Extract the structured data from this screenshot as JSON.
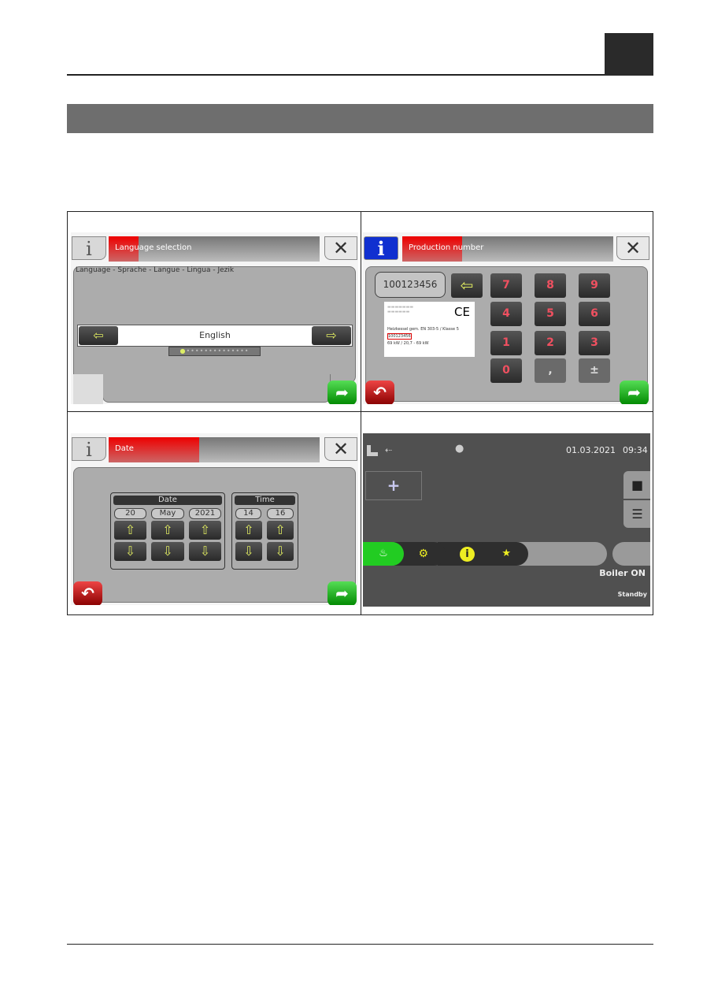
{
  "screens": {
    "language": {
      "title": "Language selection",
      "prompt": "Language - Sprache - Langue - Lingua - Jezik",
      "value": "English",
      "info_icon": "info-icon",
      "close_icon": "close-icon"
    },
    "production": {
      "title": "Production number",
      "value": "100123456",
      "keys": [
        "7",
        "8",
        "9",
        "4",
        "5",
        "6",
        "1",
        "2",
        "3",
        "0",
        ",",
        "±"
      ],
      "label_line1": "Heizkessel gem. EN 303-5 / Klasse 5",
      "label_number": "100123456",
      "label_line2": "69 kW / 20,7 - 69 kW",
      "ce_mark": "CE"
    },
    "date": {
      "title": "Date",
      "date_label": "Date",
      "time_label": "Time",
      "day": "20",
      "month": "May",
      "year": "2021",
      "hour": "14",
      "minute": "16"
    },
    "home": {
      "date": "01.03.2021",
      "time": "09:34",
      "add": "+",
      "status": "Boiler ON",
      "substatus": "Standby"
    }
  },
  "colors": {
    "accent_red": "#e00000",
    "accent_green": "#22aa22",
    "title_gray": "#6e6e6e"
  }
}
